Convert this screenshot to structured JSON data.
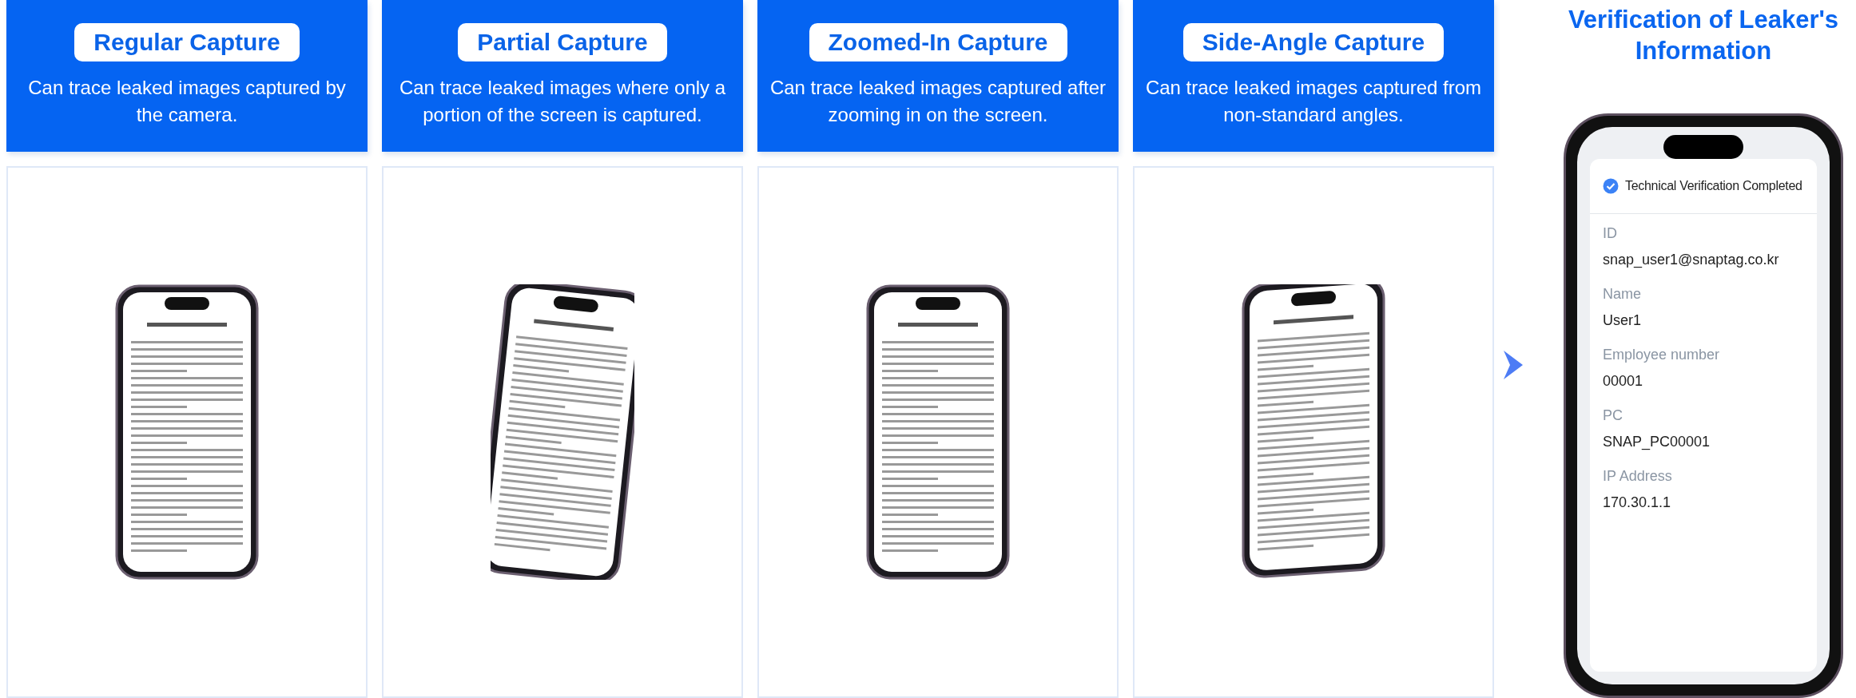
{
  "capture_panels": [
    {
      "title": "Regular Capture",
      "description": "Can trace leaked images captured by the camera."
    },
    {
      "title": "Partial Capture",
      "description": "Can trace leaked images where only a portion of the screen is captured."
    },
    {
      "title": "Zoomed-In Capture",
      "description": "Can trace leaked images captured after zooming in on the screen."
    },
    {
      "title": "Side-Angle Capture",
      "description": "Can trace leaked images captured from non-standard angles."
    }
  ],
  "result": {
    "title": "Verification of Leaker's Information",
    "status": "Technical Verification Completed",
    "fields": [
      {
        "label": "ID",
        "value": "snap_user1@snaptag.co.kr"
      },
      {
        "label": "Name",
        "value": "User1"
      },
      {
        "label": "Employee number",
        "value": "00001"
      },
      {
        "label": "PC",
        "value": "SNAP_PC00001"
      },
      {
        "label": "IP Address",
        "value": "170.30.1.1"
      }
    ]
  }
}
